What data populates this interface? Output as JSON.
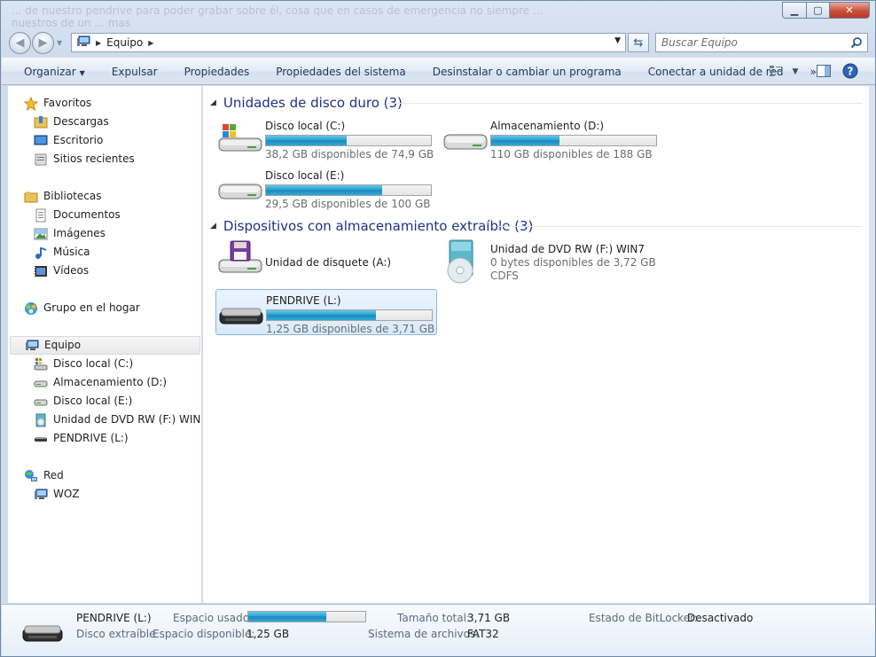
{
  "window": {
    "title_ghost": "... de nuestro pendrive para poder grabar sobre él, cosa que en casos de emergencia no siempre ... nuestros de un ... mas"
  },
  "address": {
    "crumbs": [
      "Equipo"
    ]
  },
  "search": {
    "placeholder": "Buscar Equipo"
  },
  "toolbar": {
    "organize": "Organizar",
    "eject": "Expulsar",
    "properties": "Propiedades",
    "system_properties": "Propiedades del sistema",
    "uninstall": "Desinstalar o cambiar un programa",
    "map_drive": "Conectar a unidad de red",
    "more": "»"
  },
  "nav": {
    "favorites": {
      "label": "Favoritos",
      "items": [
        "Descargas",
        "Escritorio",
        "Sitios recientes"
      ]
    },
    "libraries": {
      "label": "Bibliotecas",
      "items": [
        "Documentos",
        "Imágenes",
        "Música",
        "Vídeos"
      ]
    },
    "homegroup": "Grupo en el hogar",
    "computer": {
      "label": "Equipo",
      "items": [
        "Disco local (C:)",
        "Almacenamiento (D:)",
        "Disco local (E:)",
        "Unidad de DVD RW (F:) WIN7",
        "PENDRIVE (L:)"
      ]
    },
    "network": {
      "label": "Red",
      "items": [
        "WOZ"
      ]
    }
  },
  "content": {
    "hard_disks_header": "Unidades de disco duro (3)",
    "removable_header": "Dispositivos con almacenamiento extraíble (3)",
    "drives": {
      "c": {
        "name": "Disco local (C:)",
        "free_text": "38,2 GB disponibles de 74,9 GB",
        "used_fraction": 0.49
      },
      "d": {
        "name": "Almacenamiento (D:)",
        "free_text": "110 GB disponibles de 188 GB",
        "used_fraction": 0.415
      },
      "e": {
        "name": "Disco local (E:)",
        "free_text": "29,5 GB disponibles de 100 GB",
        "used_fraction": 0.705
      },
      "a": {
        "name": "Unidad de disquete (A:)"
      },
      "f": {
        "name": "Unidad de DVD RW (F:) WIN7",
        "free_text": "0 bytes disponibles de 3,72 GB",
        "fs": "CDFS"
      },
      "l": {
        "name": "PENDRIVE (L:)",
        "free_text": "1,25 GB disponibles de 3,71 GB",
        "used_fraction": 0.663
      }
    }
  },
  "details": {
    "name": "PENDRIVE (L:)",
    "type": "Disco extraíble",
    "used_label": "Espacio usado:",
    "free_label": "Espacio disponible:",
    "free_value": "1,25 GB",
    "total_label": "Tamaño total:",
    "total_value": "3,71 GB",
    "fs_label": "Sistema de archivos:",
    "fs_value": "FAT32",
    "bitlocker_label": "Estado de BitLocker:",
    "bitlocker_value": "Desactivado",
    "used_fraction": 0.663
  },
  "colors": {
    "header_blue": "#1e3287",
    "bar_fill": "#29a2d2",
    "toolbar_text": "#1e395b"
  }
}
